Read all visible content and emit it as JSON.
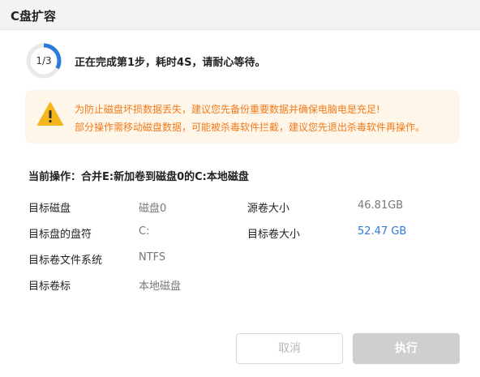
{
  "window": {
    "title": "C盘扩容"
  },
  "progress": {
    "label": "1/3",
    "current": 1,
    "total": 3,
    "fraction": 0.33
  },
  "status": {
    "message": "正在完成第1步，耗时4S，请耐心等待。"
  },
  "warning": {
    "icon": "warning-triangle-icon",
    "line1": "为防止磁盘坏损数据丢失，建议您先备份重要数据并确保电脑电是充足!",
    "line2": "部分操作需移动磁盘数据，可能被杀毒软件拦截，建议您先退出杀毒软件再操作。"
  },
  "operation": {
    "title": "当前操作：合并E:新加卷到磁盘0的C:本地磁盘"
  },
  "details": {
    "target_disk_label": "目标磁盘",
    "target_disk_value": "磁盘0",
    "target_letter_label": "目标盘的盘符",
    "target_letter_value": "C:",
    "target_fs_label": "目标卷文件系统",
    "target_fs_value": "NTFS",
    "target_volume_label_label": "目标卷标",
    "target_volume_label_value": "本地磁盘",
    "source_size_label": "源卷大小",
    "source_size_value": "46.81GB",
    "target_size_label": "目标卷大小",
    "target_size_value": "52.47 GB"
  },
  "buttons": {
    "cancel": "取消",
    "execute": "执行"
  },
  "colors": {
    "accent": "#2e7ad8",
    "warning_text": "#f27a1b",
    "warning_bg": "#fff6ea",
    "warning_icon": "#f5b51c",
    "progress_track": "#e9e9e9",
    "progress_fill": "#2e7ad8"
  }
}
